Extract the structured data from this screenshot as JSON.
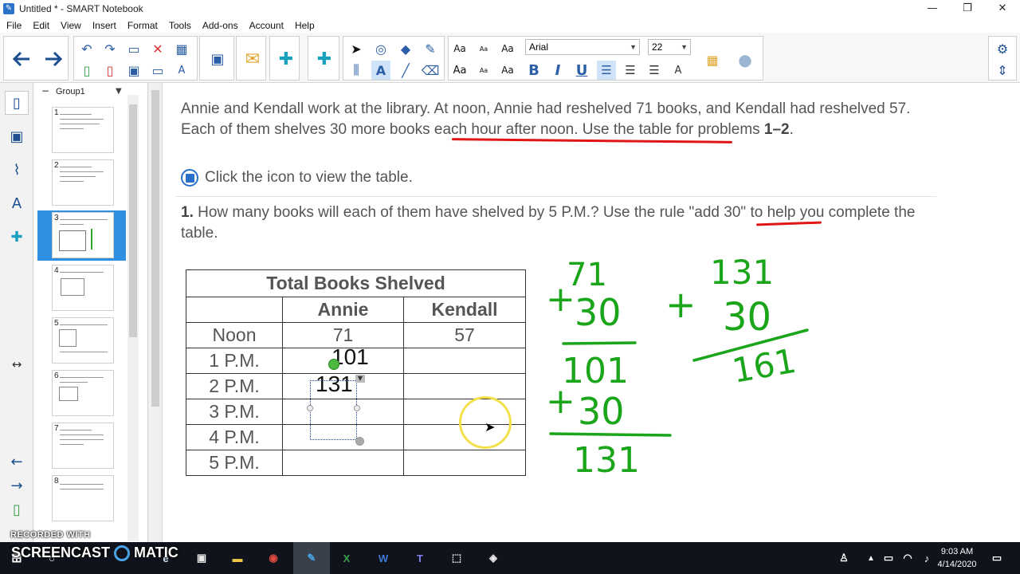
{
  "window": {
    "title": "Untitled * - SMART Notebook",
    "minimize": "—",
    "maximize": "❐",
    "close": "✕"
  },
  "menu": [
    "File",
    "Edit",
    "View",
    "Insert",
    "Format",
    "Tools",
    "Add-ons",
    "Account",
    "Help"
  ],
  "toolbar": {
    "font_name": "Arial",
    "font_size": "22",
    "text_style_labels": [
      "Aa",
      "Aa",
      "Aa",
      "Aa",
      "Aa",
      "Aa"
    ],
    "bold": "B",
    "italic": "I",
    "underline": "U",
    "accent": "#2b5ea7"
  },
  "sorter": {
    "group": "Group1",
    "pages": [
      "1",
      "2",
      "3",
      "4",
      "5",
      "6",
      "7",
      "8"
    ],
    "selected_page": "3"
  },
  "content": {
    "para_main": "Annie and Kendall work at the library. At noon, Annie had reshelved 71 books, and Kendall had reshelved 57. Each of them shelves ",
    "para_highlight": "30 more books each hour after noon.",
    "para_tail": " Use the table for problems ",
    "para_problems": "1–2",
    "para_end": ".",
    "click_text": "Click the icon to view the table.",
    "q_num": "1.",
    "q_text_a": " How many books will each of them have shelved by 5 P.M.? Use the rule \"",
    "q_rule": "add 30",
    "q_text_b": "\" to help you complete the table."
  },
  "table": {
    "title": "Total Books Shelved",
    "headers": [
      "",
      "Annie",
      "Kendall"
    ],
    "rows": [
      {
        "time": "Noon",
        "annie": "71",
        "kendall": "57"
      },
      {
        "time": "1 P.M.",
        "annie": "",
        "kendall": ""
      },
      {
        "time": "2 P.M.",
        "annie": "",
        "kendall": ""
      },
      {
        "time": "3 P.M.",
        "annie": "",
        "kendall": ""
      },
      {
        "time": "4 P.M.",
        "annie": "",
        "kendall": ""
      },
      {
        "time": "5 P.M.",
        "annie": "",
        "kendall": ""
      }
    ],
    "typed_1pm": "101",
    "typed_2pm": "131"
  },
  "ink": {
    "color": "#1aa51a",
    "calc1": [
      "71",
      "+",
      "30",
      "101"
    ],
    "calc2": [
      "101",
      "+",
      "30",
      "131"
    ],
    "calc3": [
      "131",
      "+",
      "30",
      "161"
    ],
    "underline_color": "#e01616"
  },
  "taskbar": {
    "time": "9:03 AM",
    "date": "4/14/2020",
    "recorded_with": "RECORDED WITH",
    "brand": "SCREENCAST",
    "brand2": "MATIC"
  }
}
